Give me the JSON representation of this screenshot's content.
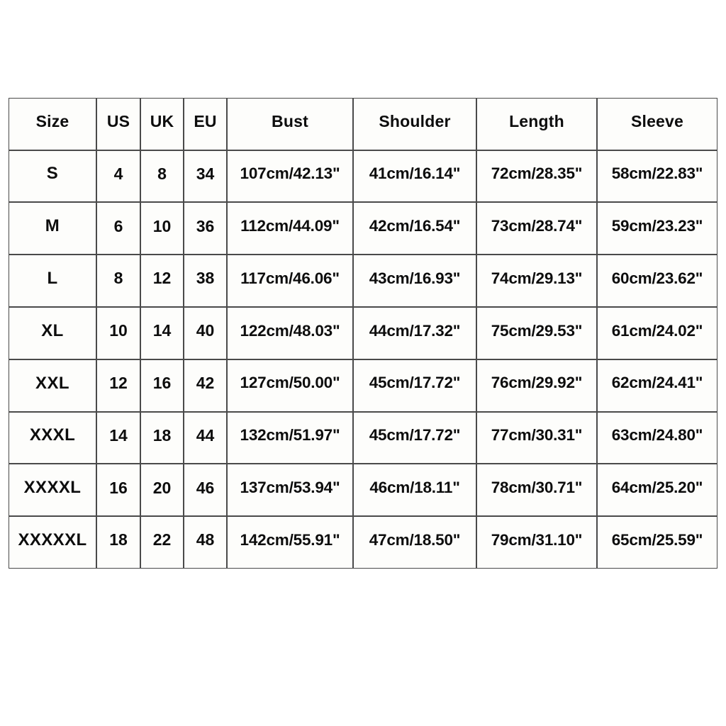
{
  "table": {
    "columns": [
      {
        "key": "size",
        "label": "Size"
      },
      {
        "key": "us",
        "label": "US"
      },
      {
        "key": "uk",
        "label": "UK"
      },
      {
        "key": "eu",
        "label": "EU"
      },
      {
        "key": "bust",
        "label": "Bust"
      },
      {
        "key": "shoulder",
        "label": "Shoulder"
      },
      {
        "key": "length",
        "label": "Length"
      },
      {
        "key": "sleeve",
        "label": "Sleeve"
      }
    ],
    "rows": [
      {
        "size": "S",
        "us": "4",
        "uk": "8",
        "eu": "34",
        "bust": "107cm/42.13\"",
        "shoulder": "41cm/16.14\"",
        "length": "72cm/28.35\"",
        "sleeve": "58cm/22.83\""
      },
      {
        "size": "M",
        "us": "6",
        "uk": "10",
        "eu": "36",
        "bust": "112cm/44.09\"",
        "shoulder": "42cm/16.54\"",
        "length": "73cm/28.74\"",
        "sleeve": "59cm/23.23\""
      },
      {
        "size": "L",
        "us": "8",
        "uk": "12",
        "eu": "38",
        "bust": "117cm/46.06\"",
        "shoulder": "43cm/16.93\"",
        "length": "74cm/29.13\"",
        "sleeve": "60cm/23.62\""
      },
      {
        "size": "XL",
        "us": "10",
        "uk": "14",
        "eu": "40",
        "bust": "122cm/48.03\"",
        "shoulder": "44cm/17.32\"",
        "length": "75cm/29.53\"",
        "sleeve": "61cm/24.02\""
      },
      {
        "size": "XXL",
        "us": "12",
        "uk": "16",
        "eu": "42",
        "bust": "127cm/50.00\"",
        "shoulder": "45cm/17.72\"",
        "length": "76cm/29.92\"",
        "sleeve": "62cm/24.41\""
      },
      {
        "size": "XXXL",
        "us": "14",
        "uk": "18",
        "eu": "44",
        "bust": "132cm/51.97\"",
        "shoulder": "45cm/17.72\"",
        "length": "77cm/30.31\"",
        "sleeve": "63cm/24.80\""
      },
      {
        "size": "XXXXL",
        "us": "16",
        "uk": "20",
        "eu": "46",
        "bust": "137cm/53.94\"",
        "shoulder": "46cm/18.11\"",
        "length": "78cm/30.71\"",
        "sleeve": "64cm/25.20\""
      },
      {
        "size": "XXXXXL",
        "us": "18",
        "uk": "22",
        "eu": "48",
        "bust": "142cm/55.91\"",
        "shoulder": "47cm/18.50\"",
        "length": "79cm/31.10\"",
        "sleeve": "65cm/25.59\""
      }
    ]
  },
  "colors": {
    "page_background": "#ffffff",
    "cell_background": "#fdfdfb",
    "border": "#4a4a4a",
    "text": "#0d0d0d"
  }
}
